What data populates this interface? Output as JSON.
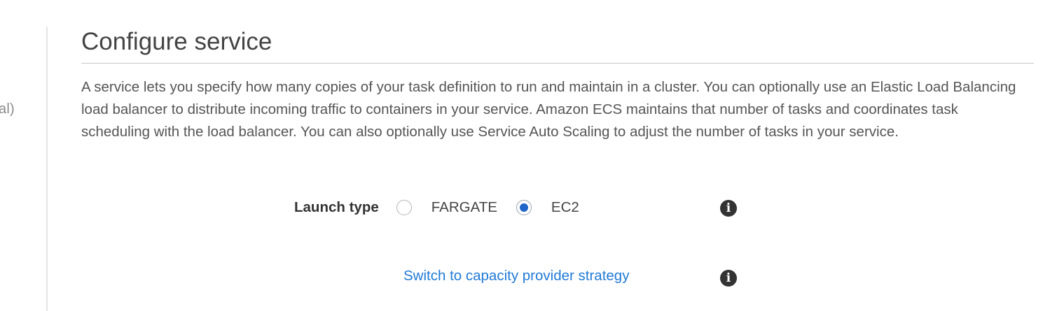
{
  "sidebar": {
    "fragment_text": "al)"
  },
  "section": {
    "title": "Configure service",
    "description": "A service lets you specify how many copies of your task definition to run and maintain in a cluster. You can optionally use an Elastic Load Balancing load balancer to distribute incoming traffic to containers in your service. Amazon ECS maintains that number of tasks and coordinates task scheduling with the load balancer. You can also optionally use Service Auto Scaling to adjust the number of tasks in your service."
  },
  "launch_type": {
    "label": "Launch type",
    "options": [
      {
        "label": "FARGATE",
        "selected": false
      },
      {
        "label": "EC2",
        "selected": true
      }
    ],
    "info_icon": "info-icon"
  },
  "capacity_provider": {
    "link_text": "Switch to capacity provider strategy",
    "info_icon": "info-icon"
  },
  "colors": {
    "link": "#1f7ad6",
    "radio_selected": "#1f66c9",
    "text": "#444444"
  }
}
